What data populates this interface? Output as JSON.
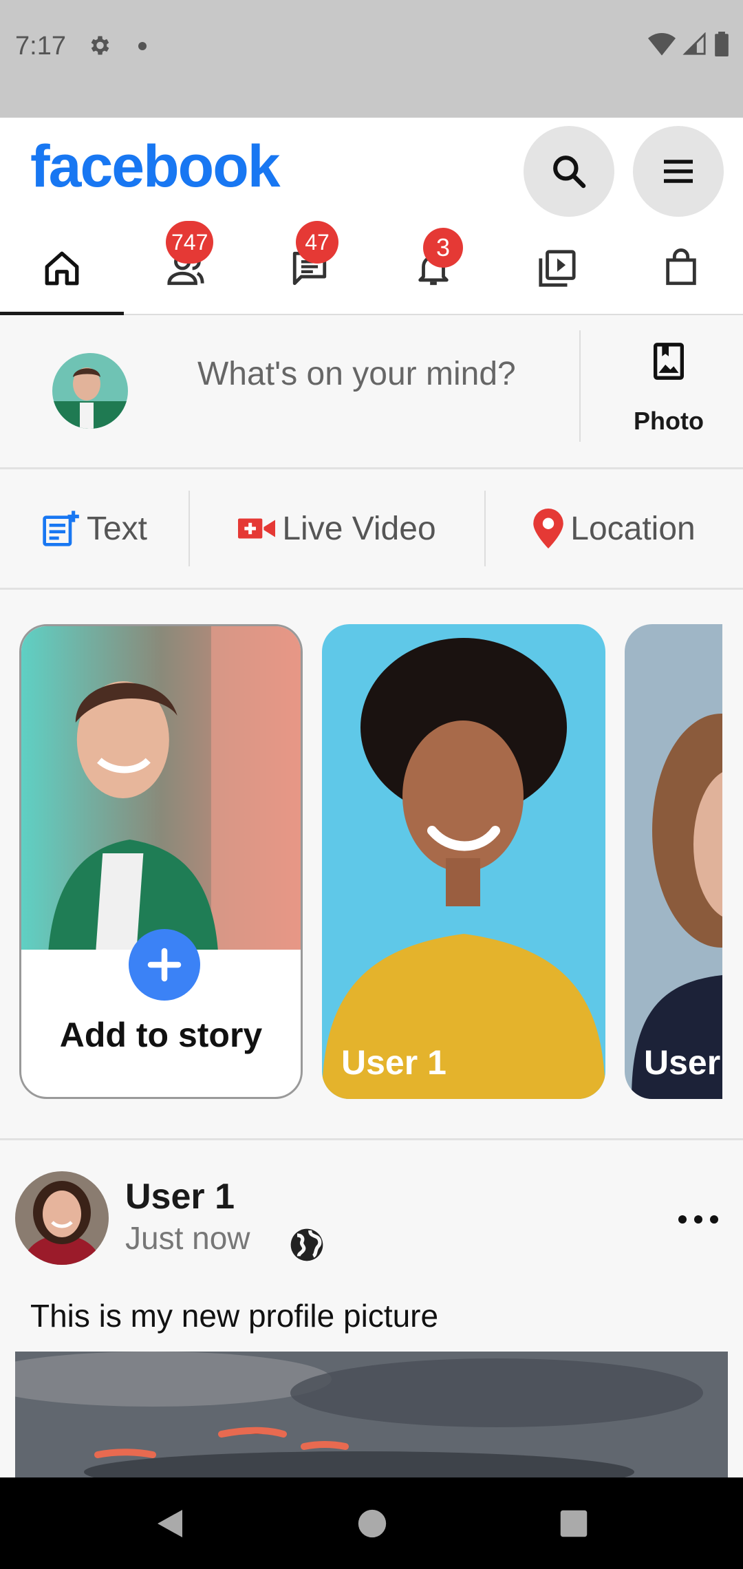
{
  "status_bar": {
    "time": "7:17"
  },
  "header": {
    "logo": "facebook",
    "search_icon": "search-icon",
    "menu_icon": "menu-icon"
  },
  "tabs": [
    {
      "name": "home",
      "icon": "home-icon",
      "active": true,
      "badge": ""
    },
    {
      "name": "friends",
      "icon": "friends-icon",
      "active": false,
      "badge": "747"
    },
    {
      "name": "messages",
      "icon": "messages-icon",
      "active": false,
      "badge": "47"
    },
    {
      "name": "notifications",
      "icon": "bell-icon",
      "active": false,
      "badge": "3"
    },
    {
      "name": "watch",
      "icon": "video-icon",
      "active": false,
      "badge": ""
    },
    {
      "name": "marketplace",
      "icon": "shopping-bag-icon",
      "active": false,
      "badge": ""
    }
  ],
  "composer": {
    "prompt": "What's on your mind?",
    "photo_label": "Photo"
  },
  "actions": {
    "text_label": "Text",
    "live_label": "Live Video",
    "location_label": "Location"
  },
  "stories": {
    "create_label": "Add to story",
    "items": [
      {
        "name": "User 1"
      },
      {
        "name": "User"
      }
    ]
  },
  "post": {
    "author": "User 1",
    "time": "Just now",
    "caption": "This is my new profile picture"
  },
  "colors": {
    "brand": "#1877f2",
    "badge": "#e53935",
    "plus": "#3b82f6",
    "live": "#e53935",
    "location": "#e53935",
    "text_icon": "#1877f2"
  }
}
